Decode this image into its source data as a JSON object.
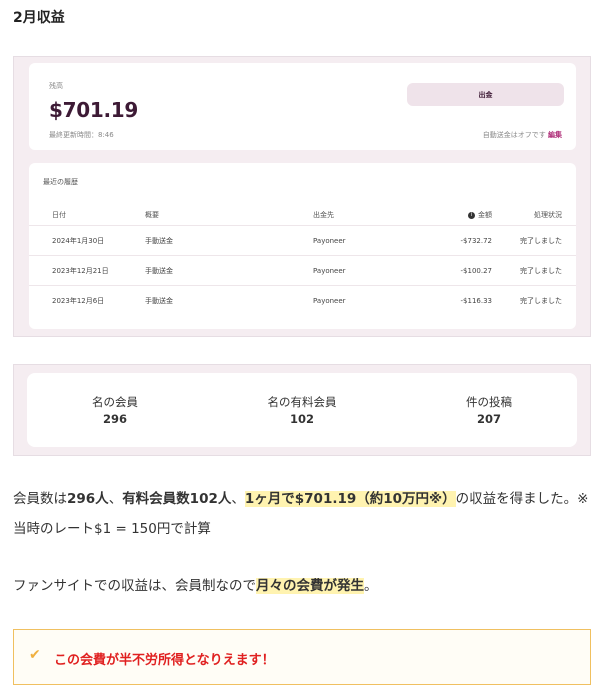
{
  "heading": "2月収益",
  "balance": {
    "label": "残高",
    "amount": "$701.19",
    "updated": "最終更新時間：8:46",
    "withdraw_button": "出金",
    "auto_text": "自動送金はオフです",
    "edit_link": "編集"
  },
  "history": {
    "title": "最近の履歴",
    "columns": {
      "date": "日付",
      "summary": "概要",
      "destination": "出金先",
      "amount": "金額",
      "status": "処理状況"
    },
    "rows": [
      {
        "date": "2024年1月30日",
        "summary": "手動送金",
        "destination": "Payoneer",
        "amount": "-$732.72",
        "status": "完了しました"
      },
      {
        "date": "2023年12月21日",
        "summary": "手動送金",
        "destination": "Payoneer",
        "amount": "-$100.27",
        "status": "完了しました"
      },
      {
        "date": "2023年12月6日",
        "summary": "手動送金",
        "destination": "Payoneer",
        "amount": "-$116.33",
        "status": "完了しました"
      }
    ]
  },
  "stats": [
    {
      "label": "名の会員",
      "value": "296"
    },
    {
      "label": "名の有料会員",
      "value": "102"
    },
    {
      "label": "件の投稿",
      "value": "207"
    }
  ],
  "paragraph1": {
    "t1": "会員数は",
    "b1": "296人",
    "t2": "、",
    "b2": "有料会員数102人",
    "t3": "、",
    "hl": "1ヶ月で$701.19（約10万円※）",
    "t4": "の収益を得ました。※当時のレート$1 = 150円で計算"
  },
  "paragraph2": {
    "t1": "ファンサイトでの収益は、会員制なので",
    "hl": "月々の会費が発生",
    "t2": "。"
  },
  "alert": {
    "icon": "check-icon",
    "message": "この会費が半不労所得となりえます！"
  }
}
